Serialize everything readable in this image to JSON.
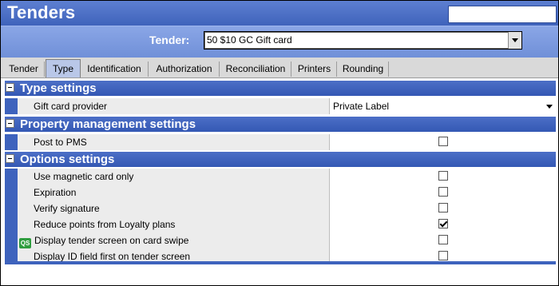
{
  "window": {
    "title": "Tenders"
  },
  "tender": {
    "label": "Tender:",
    "selected": "50 $10 GC Gift card"
  },
  "tabs": [
    {
      "label": "Tender",
      "active": false
    },
    {
      "label": "Type",
      "active": true
    },
    {
      "label": "Identification",
      "active": false
    },
    {
      "label": "Authorization",
      "active": false
    },
    {
      "label": "Reconciliation",
      "active": false
    },
    {
      "label": "Printers",
      "active": false
    },
    {
      "label": "Rounding",
      "active": false
    }
  ],
  "sections": {
    "type": {
      "title": "Type settings",
      "rows": [
        {
          "label": "Gift card provider",
          "value": "Private Label",
          "kind": "dropdown"
        }
      ]
    },
    "pms": {
      "title": "Property management settings",
      "rows": [
        {
          "label": "Post to PMS",
          "checked": false
        }
      ]
    },
    "options": {
      "title": "Options settings",
      "rows": [
        {
          "label": "Use magnetic card only",
          "checked": false
        },
        {
          "label": "Expiration",
          "checked": false
        },
        {
          "label": "Verify signature",
          "checked": false
        },
        {
          "label": "Reduce points from Loyalty plans",
          "checked": true
        },
        {
          "label": "Display tender screen on card swipe",
          "checked": false,
          "icon": "qs-icon",
          "icon_text": "QS"
        },
        {
          "label": "Display ID field first on tender screen",
          "checked": false
        }
      ]
    }
  },
  "colors": {
    "header": "#3f63bb",
    "accent": "#3e63bd",
    "tab_active": "#b9c7e8"
  }
}
